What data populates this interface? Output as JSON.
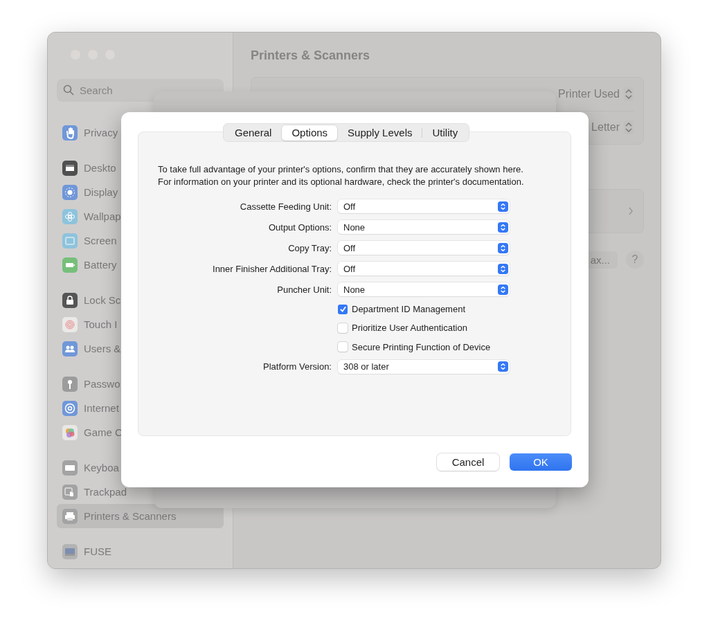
{
  "window": {
    "title": "Printers & Scanners"
  },
  "sidebar": {
    "search": {
      "placeholder": "Search"
    },
    "groups": [
      [
        {
          "label": "Privacy",
          "color": "#7097d8",
          "selected": false
        }
      ],
      [
        {
          "label": "Deskto",
          "color": "#505050",
          "selected": false
        },
        {
          "label": "Display",
          "color": "#7097d8",
          "selected": false
        },
        {
          "label": "Wallpap",
          "color": "#8ec3dc",
          "selected": false
        },
        {
          "label": "Screen",
          "color": "#8ec3dc",
          "selected": false
        },
        {
          "label": "Battery",
          "color": "#76bf79",
          "selected": false
        }
      ],
      [
        {
          "label": "Lock Sc",
          "color": "#555555",
          "selected": false
        },
        {
          "label": "Touch I",
          "color": "#ebe9e8",
          "selected": false
        },
        {
          "label": "Users &",
          "color": "#7097d8",
          "selected": false
        }
      ],
      [
        {
          "label": "Passwo",
          "color": "#9c9c9c",
          "selected": false
        },
        {
          "label": "Internet",
          "color": "#7097d8",
          "selected": false
        },
        {
          "label": "Game C",
          "color": "#e9e7e6",
          "selected": false
        }
      ],
      [
        {
          "label": "Keyboa",
          "color": "#a3a3a3",
          "selected": false
        },
        {
          "label": "Trackpad",
          "color": "#a3a3a3",
          "selected": false
        },
        {
          "label": "Printers & Scanners",
          "color": "#a3a3a3",
          "selected": true
        }
      ],
      [
        {
          "label": "FUSE",
          "color": "#b3b3b3",
          "selected": false
        }
      ]
    ]
  },
  "main": {
    "default_printer": {
      "value": "Printer Used"
    },
    "paper_size": {
      "value": "Letter"
    },
    "fax_button": "ax...",
    "help_button": "?"
  },
  "dialog": {
    "tabs": [
      {
        "label": "General",
        "selected": false
      },
      {
        "label": "Options",
        "selected": true
      },
      {
        "label": "Supply Levels",
        "selected": false
      },
      {
        "label": "Utility",
        "selected": false
      }
    ],
    "description": "To take full advantage of your printer's options, confirm that they are accurately shown here. For information on your printer and its optional hardware, check the printer's documentation.",
    "fields": [
      {
        "kind": "popup",
        "label": "Cassette Feeding Unit:",
        "value": "Off"
      },
      {
        "kind": "popup",
        "label": "Output Options:",
        "value": "None"
      },
      {
        "kind": "popup",
        "label": "Copy Tray:",
        "value": "Off"
      },
      {
        "kind": "popup",
        "label": "Inner Finisher Additional Tray:",
        "value": "Off"
      },
      {
        "kind": "popup",
        "label": "Puncher Unit:",
        "value": "None"
      },
      {
        "kind": "checkbox",
        "label": "Department ID Management",
        "checked": true
      },
      {
        "kind": "checkbox",
        "label": "Prioritize User Authentication",
        "checked": false
      },
      {
        "kind": "checkbox",
        "label": "Secure Printing Function of Device",
        "checked": false
      },
      {
        "kind": "popup",
        "label": "Platform Version:",
        "value": "308 or later"
      }
    ],
    "buttons": [
      {
        "label": "Cancel",
        "default": false
      },
      {
        "label": "OK",
        "default": true
      }
    ]
  }
}
